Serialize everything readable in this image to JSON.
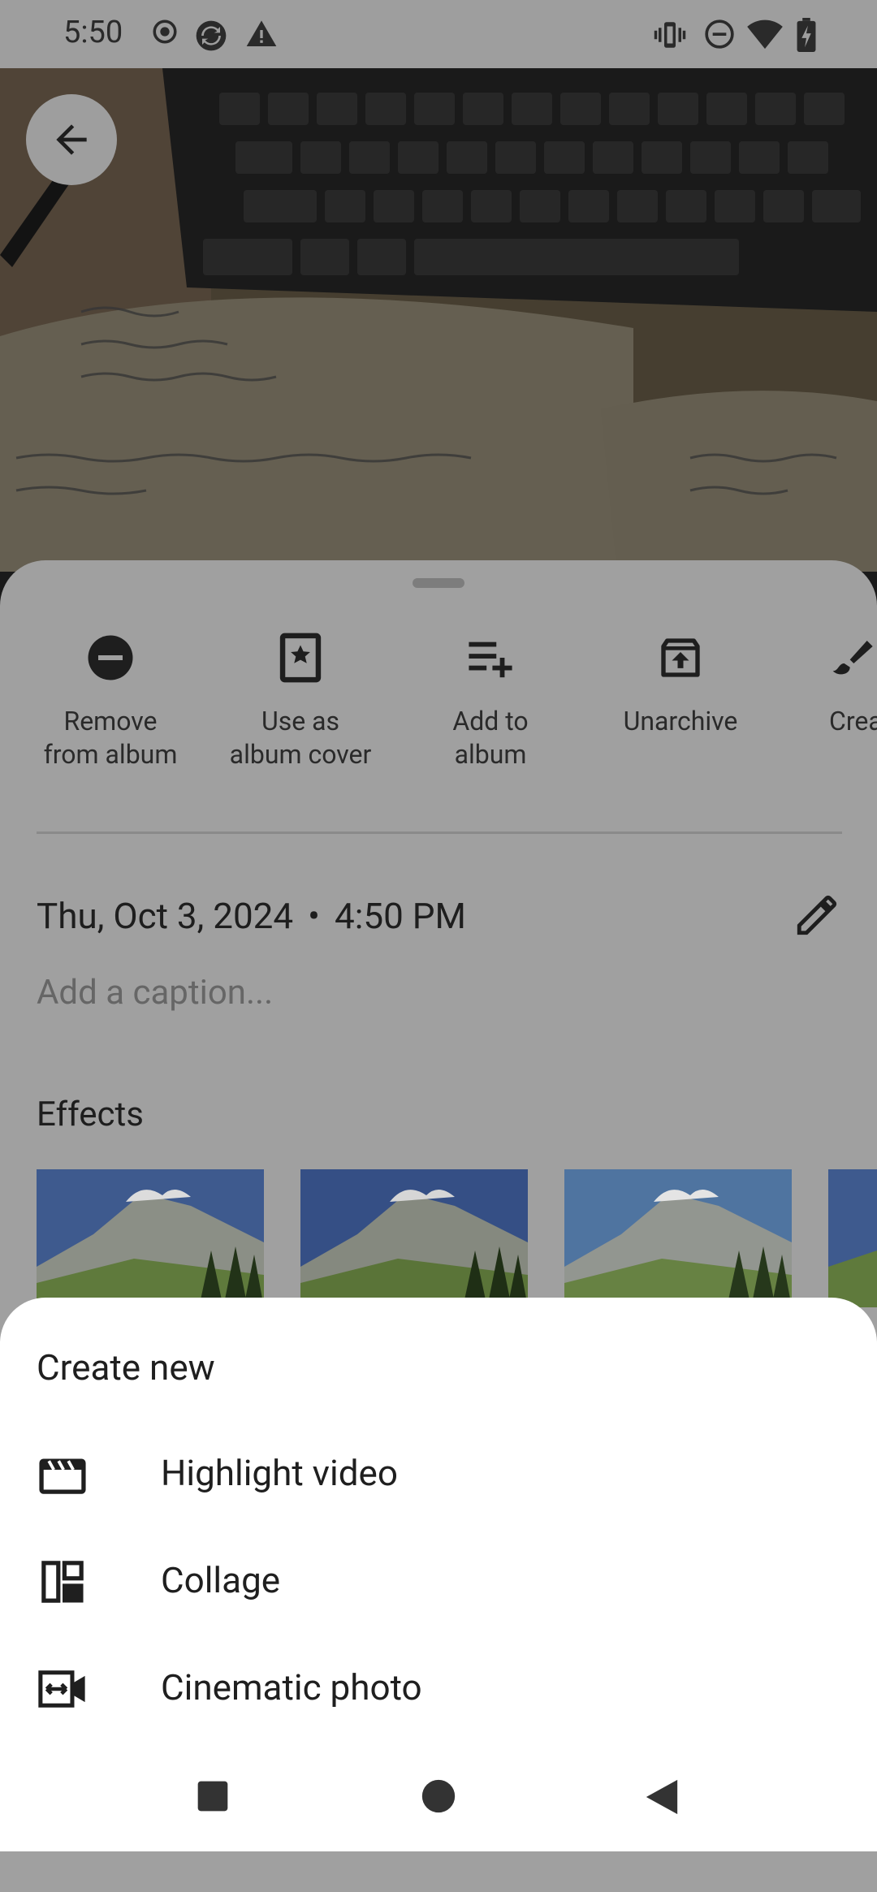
{
  "status_bar": {
    "time": "5:50",
    "left_icons": [
      "record-icon",
      "sync-icon",
      "alert-icon"
    ],
    "right_icons": [
      "vibrate-icon",
      "do-not-disturb-icon",
      "wifi-icon",
      "battery-icon"
    ]
  },
  "actions": [
    {
      "icon": "remove-icon",
      "label": "Remove\nfrom album"
    },
    {
      "icon": "album-cover-icon",
      "label": "Use as\nalbum cover"
    },
    {
      "icon": "add-to-album-icon",
      "label": "Add to\nalbum"
    },
    {
      "icon": "unarchive-icon",
      "label": "Unarchive"
    },
    {
      "icon": "brush-icon",
      "label": "Crea"
    }
  ],
  "info": {
    "date": "Thu, Oct 3, 2024",
    "separator": "•",
    "time": "4:50 PM",
    "caption_placeholder": "Add a caption...",
    "effects_title": "Effects"
  },
  "bottom_sheet": {
    "title": "Create new",
    "items": [
      {
        "icon": "highlight-video-icon",
        "label": "Highlight video"
      },
      {
        "icon": "collage-icon",
        "label": "Collage"
      },
      {
        "icon": "cinematic-photo-icon",
        "label": "Cinematic photo"
      }
    ]
  },
  "colors": {
    "scrim": "#9e9e9e",
    "sheet_bg": "#ffffff",
    "text_primary": "#1f1f1f"
  }
}
